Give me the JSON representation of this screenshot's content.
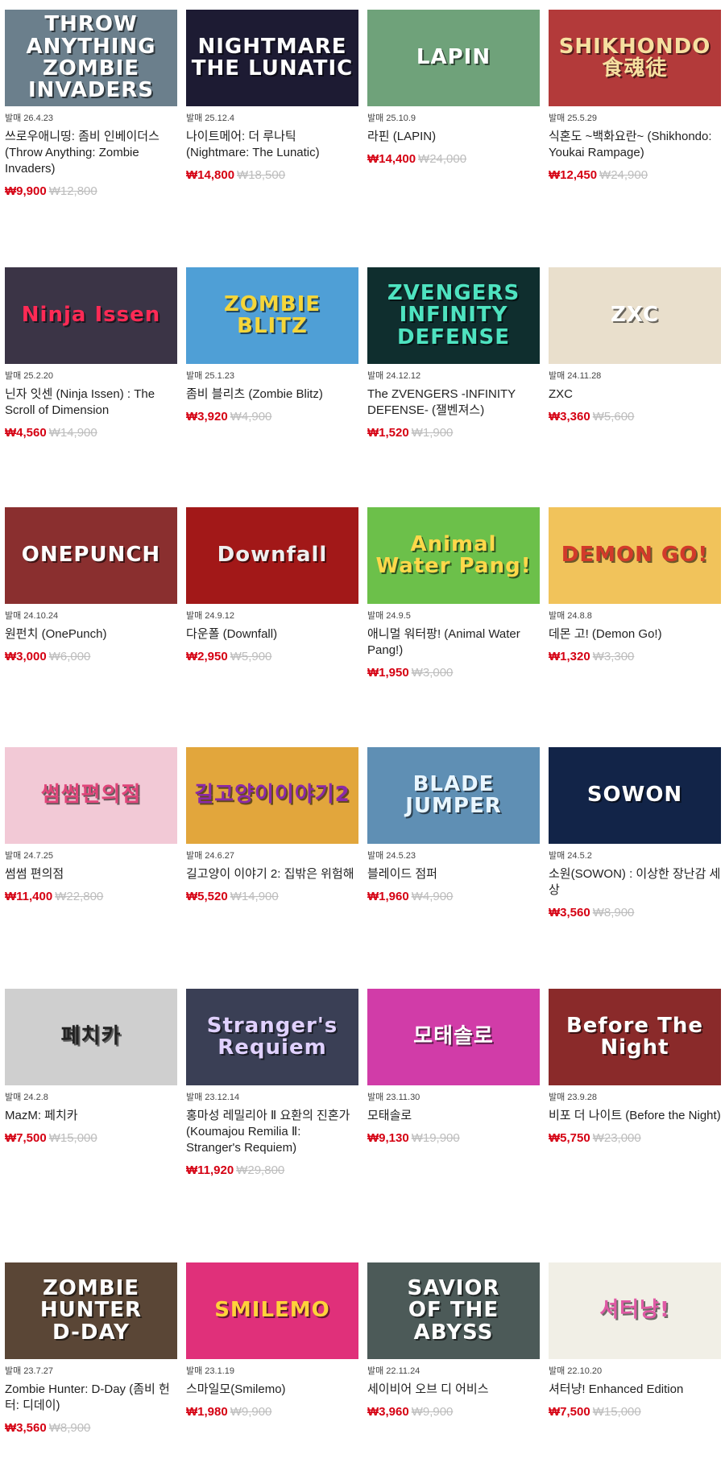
{
  "release_prefix": "발매",
  "rows": [
    [
      {
        "thumb_text": "THROW ANYTHING\nZOMBIE INVADERS",
        "release": "발매 26.4.23",
        "title": "쓰로우애니띵: 좀비 인베이더스 (Throw Anything: Zombie Invaders)",
        "sale": "₩9,900",
        "orig": "₩12,800",
        "bg": "#6b7f8c",
        "fg": "#ffffff"
      },
      {
        "thumb_text": "NIGHTMARE\nTHE LUNATIC",
        "release": "발매 25.12.4",
        "title": "나이트메어: 더 루나틱 (Nightmare: The Lunatic)",
        "sale": "₩14,800",
        "orig": "₩18,500",
        "bg": "#1d1b33",
        "fg": "#ffffff"
      },
      {
        "thumb_text": "LAPIN",
        "release": "발매 25.10.9",
        "title": "라핀 (LAPIN)",
        "sale": "₩14,400",
        "orig": "₩24,000",
        "bg": "#6fa27a",
        "fg": "#ffffff"
      },
      {
        "thumb_text": "SHIKHONDO\n食魂徒",
        "release": "발매 25.5.29",
        "title": "식혼도 ~백화요란~ (Shikhondo: Youkai Rampage)",
        "sale": "₩12,450",
        "orig": "₩24,900",
        "bg": "#b33a3a",
        "fg": "#f6e0a0"
      }
    ],
    [
      {
        "thumb_text": "Ninja Issen",
        "release": "발매 25.2.20",
        "title": "닌자 잇센 (Ninja Issen) : The Scroll of Dimension",
        "sale": "₩4,560",
        "orig": "₩14,900",
        "bg": "#3b3446",
        "fg": "#ff2a55"
      },
      {
        "thumb_text": "ZOMBIE BLITZ",
        "release": "발매 25.1.23",
        "title": "좀비 블리츠 (Zombie Blitz)",
        "sale": "₩3,920",
        "orig": "₩4,900",
        "bg": "#4f9fd6",
        "fg": "#f5d63a"
      },
      {
        "thumb_text": "ZVENGERS\nINFINITY DEFENSE",
        "release": "발매 24.12.12",
        "title": "The ZVENGERS -INFINITY DEFENSE- (잴벤져스)",
        "sale": "₩1,520",
        "orig": "₩1,900",
        "bg": "#0f2e2e",
        "fg": "#4ee3c0"
      },
      {
        "thumb_text": "ZXC",
        "release": "발매 24.11.28",
        "title": "ZXC",
        "sale": "₩3,360",
        "orig": "₩5,600",
        "bg": "#e9dfcc",
        "fg": "#ffffff"
      }
    ],
    [
      {
        "thumb_text": "ONEPUNCH",
        "release": "발매 24.10.24",
        "title": "원펀치 (OnePunch)",
        "sale": "₩3,000",
        "orig": "₩6,000",
        "bg": "#8a2f2f",
        "fg": "#ffffff"
      },
      {
        "thumb_text": "Downfall",
        "release": "발매 24.9.12",
        "title": "다운폴 (Downfall)",
        "sale": "₩2,950",
        "orig": "₩5,900",
        "bg": "#a21818",
        "fg": "#eeeeee"
      },
      {
        "thumb_text": "Animal\nWater Pang!",
        "release": "발매 24.9.5",
        "title": "애니멀 워터팡! (Animal Water Pang!)",
        "sale": "₩1,950",
        "orig": "₩3,000",
        "bg": "#6cc04a",
        "fg": "#ffd84a"
      },
      {
        "thumb_text": "DEMON GO!",
        "release": "발매 24.8.8",
        "title": "데몬 고! (Demon Go!)",
        "sale": "₩1,320",
        "orig": "₩3,300",
        "bg": "#f1c35b",
        "fg": "#d23a2a"
      }
    ],
    [
      {
        "thumb_text": "썸썸편의점",
        "release": "발매 24.7.25",
        "title": "썸썸 편의점",
        "sale": "₩11,400",
        "orig": "₩22,800",
        "bg": "#f2c9d6",
        "fg": "#e0457a"
      },
      {
        "thumb_text": "길고양이이야기2",
        "release": "발매 24.6.27",
        "title": "길고양이 이야기 2: 집밖은 위험해",
        "sale": "₩5,520",
        "orig": "₩14,900",
        "bg": "#e2a63c",
        "fg": "#8b2aa8"
      },
      {
        "thumb_text": "BLADE JUMPER",
        "release": "발매 24.5.23",
        "title": "블레이드 점퍼",
        "sale": "₩1,960",
        "orig": "₩4,900",
        "bg": "#5f8fb4",
        "fg": "#e9f6ff"
      },
      {
        "thumb_text": "SOWON",
        "release": "발매 24.5.2",
        "title": "소원(SOWON) : 이상한 장난감 세상",
        "sale": "₩3,560",
        "orig": "₩8,900",
        "bg": "#122448",
        "fg": "#ffffff"
      }
    ],
    [
      {
        "thumb_text": "페치카",
        "release": "발매 24.2.8",
        "title": "MazM: 페치카",
        "sale": "₩7,500",
        "orig": "₩15,000",
        "bg": "#cfcfcf",
        "fg": "#222222"
      },
      {
        "thumb_text": "Stranger's Requiem",
        "release": "발매 23.12.14",
        "title": "홍마성 레밀리아 Ⅱ 요환의 진혼가 (Koumajou Remilia Ⅱ: Stranger's Requiem)",
        "sale": "₩11,920",
        "orig": "₩29,800",
        "bg": "#3a3f55",
        "fg": "#e0d1ff"
      },
      {
        "thumb_text": "모태솔로",
        "release": "발매 23.11.30",
        "title": "모태솔로",
        "sale": "₩9,130",
        "orig": "₩19,900",
        "bg": "#d13ca8",
        "fg": "#ffffff"
      },
      {
        "thumb_text": "Before The Night",
        "release": "발매 23.9.28",
        "title": "비포 더 나이트 (Before the Night)",
        "sale": "₩5,750",
        "orig": "₩23,000",
        "bg": "#8a2a2a",
        "fg": "#ffffff"
      }
    ],
    [
      {
        "thumb_text": "ZOMBIE HUNTER\nD-DAY",
        "release": "발매 23.7.27",
        "title": "Zombie Hunter: D-Day (좀비 헌터: 디데이)",
        "sale": "₩3,560",
        "orig": "₩8,900",
        "bg": "#5a4636",
        "fg": "#ffffff"
      },
      {
        "thumb_text": "SMILEMO",
        "release": "발매 23.1.19",
        "title": "스마일모(Smilemo)",
        "sale": "₩1,980",
        "orig": "₩9,900",
        "bg": "#e0307a",
        "fg": "#ffd23a"
      },
      {
        "thumb_text": "SAVIOR\nOF THE ABYSS",
        "release": "발매 22.11.24",
        "title": "세이비어 오브 디 어비스",
        "sale": "₩3,960",
        "orig": "₩9,900",
        "bg": "#4c5a58",
        "fg": "#ffffff"
      },
      {
        "thumb_text": "셔터냥!",
        "release": "발매 22.10.20",
        "title": "셔터냥! Enhanced Edition",
        "sale": "₩7,500",
        "orig": "₩15,000",
        "bg": "#f1efe6",
        "fg": "#e05aa5"
      }
    ]
  ]
}
